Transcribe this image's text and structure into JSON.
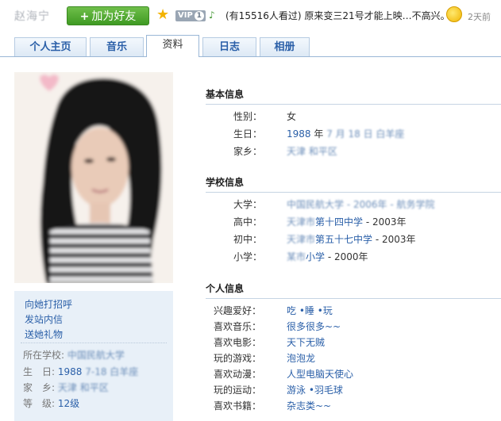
{
  "header": {
    "username": "赵海宁",
    "add_friend": "加为好友",
    "vip_label": "VIP",
    "vip_level": "1",
    "view_count_text": "(有15516人看过)",
    "status_text": "原来变三21号才能上映…不高兴。",
    "time_ago": "2天前",
    "icons": [
      "star-icon",
      "note-icon",
      "mood-icon"
    ]
  },
  "tabs": [
    {
      "label": "个人主页"
    },
    {
      "label": "音乐"
    },
    {
      "label": "资料"
    },
    {
      "label": "日志"
    },
    {
      "label": "相册"
    }
  ],
  "sidebar": {
    "actions": [
      "向她打招呼",
      "发站内信",
      "送她礼物"
    ],
    "school_label": "所在学校:",
    "school_value": "中国民航大学",
    "birthday_label": "生　日:",
    "birthday_value": "1988",
    "birthday_blur": "7-18 白羊座",
    "hometown_label": "家　乡:",
    "hometown_value": "天津 和平区",
    "level_label": "等　级:",
    "level_value": "12级"
  },
  "basic": {
    "title": "基本信息",
    "gender_label": "性别：",
    "gender_value": "女",
    "birthday_label": "生日：",
    "birth_year": "1988",
    "year_word": "年",
    "birth_blur": "7 月 18 日 白羊座",
    "hometown_label": "家乡：",
    "hometown_value": "天津 和平区"
  },
  "school": {
    "title": "学校信息",
    "rows": [
      {
        "label": "大学：",
        "blur": "中国民航大学 - 2006年 - 航务学院",
        "value": "",
        "year": ""
      },
      {
        "label": "高中：",
        "blur": "天津市",
        "value": "第十四中学",
        "year": " - 2003年"
      },
      {
        "label": "初中：",
        "blur": "天津市",
        "value": "第五十七中学",
        "year": " - 2003年"
      },
      {
        "label": "小学：",
        "blur": "某市",
        "value": "小学",
        "year": " - 2000年"
      }
    ]
  },
  "personal": {
    "title": "个人信息",
    "rows": [
      {
        "label": "兴趣爱好：",
        "value": "吃 •睡 •玩"
      },
      {
        "label": "喜欢音乐：",
        "value": "很多很多~~"
      },
      {
        "label": "喜欢电影：",
        "value": "天下无贼"
      },
      {
        "label": "玩的游戏：",
        "value": "泡泡龙"
      },
      {
        "label": "喜欢动漫：",
        "value": "人型电脑天使心"
      },
      {
        "label": "玩的运动：",
        "value": "游泳 •羽毛球"
      },
      {
        "label": "喜欢书籍：",
        "value": "杂志类~~"
      }
    ]
  }
}
